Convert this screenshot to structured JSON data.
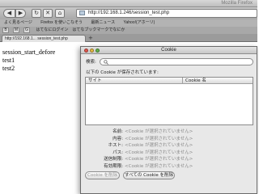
{
  "browser": {
    "window_title": "Mozilla Firefox",
    "url": "http://192.168.1.246/session_test.php",
    "bookmarks": [
      "よく見るページ",
      "Firefox を使いこなそう",
      "最新ニュース",
      "Yahoo!(アホーリ)"
    ],
    "toolbar2_text": "はてなにログイン　はてなブックマークでなにか",
    "toolbar2_buttons": [
      "B",
      "M",
      "G"
    ],
    "tab_title": "http://192.168.1... session_test.php",
    "nav": {
      "back": "◀",
      "forward": "▶",
      "reload": "↻",
      "stop": "✕",
      "home": "⌂"
    }
  },
  "page": {
    "lines": [
      "session_start_defore",
      "test1",
      "test2"
    ]
  },
  "dialog": {
    "title": "Cookie",
    "search_label": "検索:",
    "search_value": "",
    "saved_label": "以下の Cookie が保存されています:",
    "columns": {
      "site": "サイト",
      "name": "Cookie 名"
    },
    "rows": [],
    "details": [
      {
        "key": "名前:",
        "value": "<Cookie が選択されていません>"
      },
      {
        "key": "内容:",
        "value": "<Cookie が選択されていません>"
      },
      {
        "key": "ホスト:",
        "value": "<Cookie が選択されていません>"
      },
      {
        "key": "パス:",
        "value": "<Cookie が選択されていません>"
      },
      {
        "key": "送信制限:",
        "value": "<Cookie が選択されていません>"
      },
      {
        "key": "有効期限:",
        "value": "<Cookie が選択されていません>"
      }
    ],
    "buttons": {
      "remove": "Cookie を削除",
      "remove_all": "すべての Cookie を削除"
    }
  }
}
